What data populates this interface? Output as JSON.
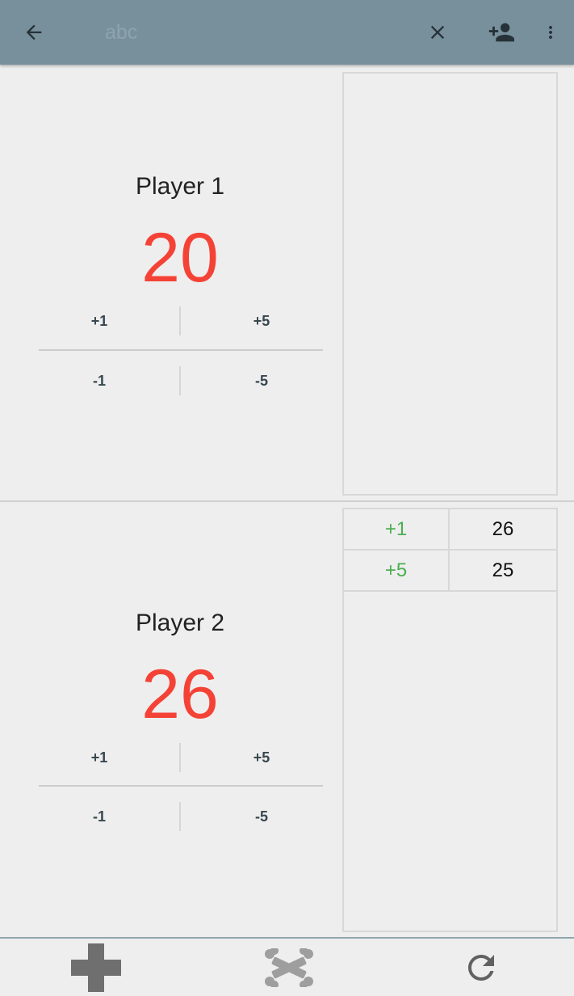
{
  "toolbar": {
    "title_placeholder": "abc",
    "icons": {
      "back": "arrow-back-icon",
      "clear": "close-icon",
      "add_player": "person-add-icon",
      "more": "more-vert-icon"
    },
    "color": "#78909c"
  },
  "players": [
    {
      "name": "Player 1",
      "life": "20",
      "buttons": {
        "plus_small": "+1",
        "plus_big": "+5",
        "minus_small": "-1",
        "minus_big": "-5"
      },
      "history": []
    },
    {
      "name": "Player 2",
      "life": "26",
      "buttons": {
        "plus_small": "+1",
        "plus_big": "+5",
        "minus_small": "-1",
        "minus_big": "-5"
      },
      "history": [
        {
          "delta": "+1",
          "total": "26"
        },
        {
          "delta": "+5",
          "total": "25"
        }
      ]
    }
  ],
  "bottom_bar": {
    "icons": {
      "add": "plus-icon",
      "dice": "crossbones-icon",
      "reset": "refresh-icon"
    }
  },
  "colors": {
    "life": "#f44336",
    "positive_delta": "#4caf50",
    "button_text": "#37474f"
  }
}
